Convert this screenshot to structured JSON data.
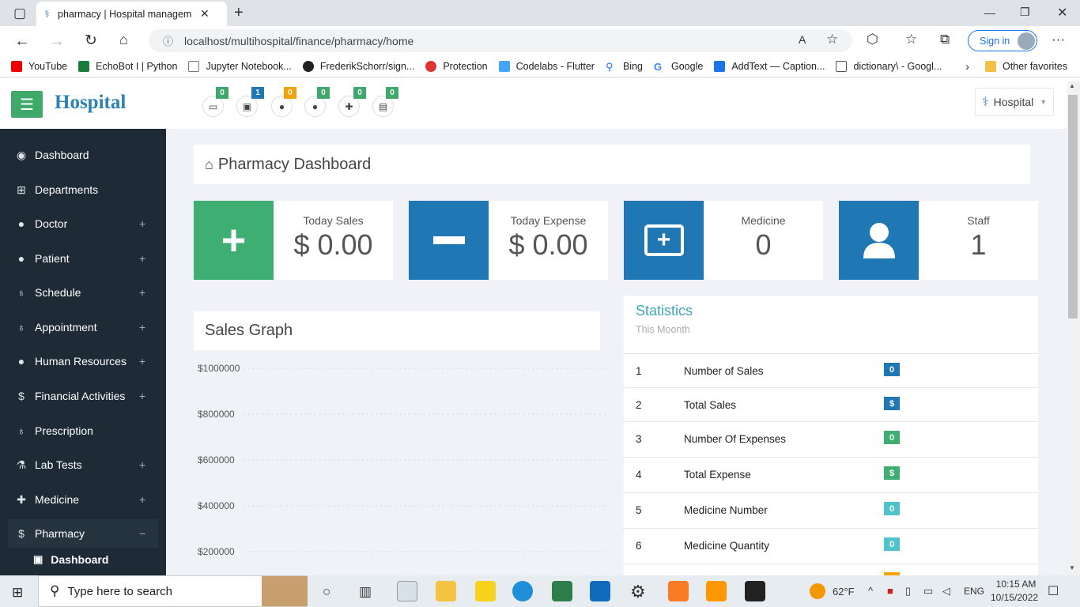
{
  "browser": {
    "tab_title": "pharmacy | Hospital management",
    "url": "localhost/multihospital/finance/pharmacy/home",
    "sign_in": "Sign in",
    "favorites": [
      "YouTube",
      "EchoBot I | Python",
      "Jupyter Notebook...",
      "FrederikSchorr/sign...",
      "Protection",
      "Codelabs - Flutter",
      "Bing",
      "Google",
      "AddText — Caption...",
      "dictionary\\ - Googl..."
    ],
    "other_favorites": "Other favorites"
  },
  "header": {
    "logo": "Hospital",
    "user_label": "Hospital",
    "notifications": [
      {
        "icon": "bed-icon",
        "count": "0",
        "color": "#3fa96c"
      },
      {
        "icon": "money-icon",
        "count": "1",
        "color": "#1f78b4"
      },
      {
        "icon": "doctor-icon",
        "count": "0",
        "color": "#f0a30a"
      },
      {
        "icon": "patient-icon",
        "count": "0",
        "color": "#3fa96c"
      },
      {
        "icon": "medkit-icon",
        "count": "0",
        "color": "#3fa96c"
      },
      {
        "icon": "clipboard-icon",
        "count": "0",
        "color": "#3fa96c"
      }
    ]
  },
  "sidebar": {
    "items": [
      {
        "label": "Dashboard",
        "expandable": false
      },
      {
        "label": "Departments",
        "expandable": false
      },
      {
        "label": "Doctor",
        "expandable": true
      },
      {
        "label": "Patient",
        "expandable": true
      },
      {
        "label": "Schedule",
        "expandable": true
      },
      {
        "label": "Appointment",
        "expandable": true
      },
      {
        "label": "Human Resources",
        "expandable": true
      },
      {
        "label": "Financial Activities",
        "expandable": true
      },
      {
        "label": "Prescription",
        "expandable": false
      },
      {
        "label": "Lab Tests",
        "expandable": true
      },
      {
        "label": "Medicine",
        "expandable": true
      },
      {
        "label": "Pharmacy",
        "expandable": true
      }
    ],
    "sub_dashboard": "Dashboard"
  },
  "main": {
    "title": "Pharmacy Dashboard",
    "cards": [
      {
        "label": "Today Sales",
        "value": "$ 0.00",
        "color": "#3fae72"
      },
      {
        "label": "Today Expense",
        "value": "$ 0.00",
        "color": "#1f78b4"
      },
      {
        "label": "Medicine",
        "value": "0",
        "color": "#1f78b4"
      },
      {
        "label": "Staff",
        "value": "1",
        "color": "#1f78b4"
      }
    ],
    "sales_graph_title": "Sales Graph",
    "statistics": {
      "title": "Statistics",
      "subtitle": "This Moonth",
      "rows": [
        {
          "num": "1",
          "label": "Number of Sales",
          "badge": "0",
          "color": "#1f78b4"
        },
        {
          "num": "2",
          "label": "Total Sales",
          "badge": "$",
          "color": "#1f78b4"
        },
        {
          "num": "3",
          "label": "Number Of Expenses",
          "badge": "0",
          "color": "#3fae72"
        },
        {
          "num": "4",
          "label": "Total Expense",
          "badge": "$",
          "color": "#3fae72"
        },
        {
          "num": "5",
          "label": "Medicine Number",
          "badge": "0",
          "color": "#4fc3c9"
        },
        {
          "num": "6",
          "label": "Medicine Quantity",
          "badge": "0",
          "color": "#4fc3c9"
        }
      ]
    }
  },
  "chart_data": {
    "type": "line",
    "title": "Sales Graph",
    "y_ticks": [
      "$1000000",
      "$800000",
      "$600000",
      "$400000",
      "$200000"
    ],
    "series": []
  },
  "taskbar": {
    "search_placeholder": "Type here to search",
    "weather": "62°F",
    "lang": "ENG",
    "time": "10:15 AM",
    "date": "10/15/2022"
  }
}
